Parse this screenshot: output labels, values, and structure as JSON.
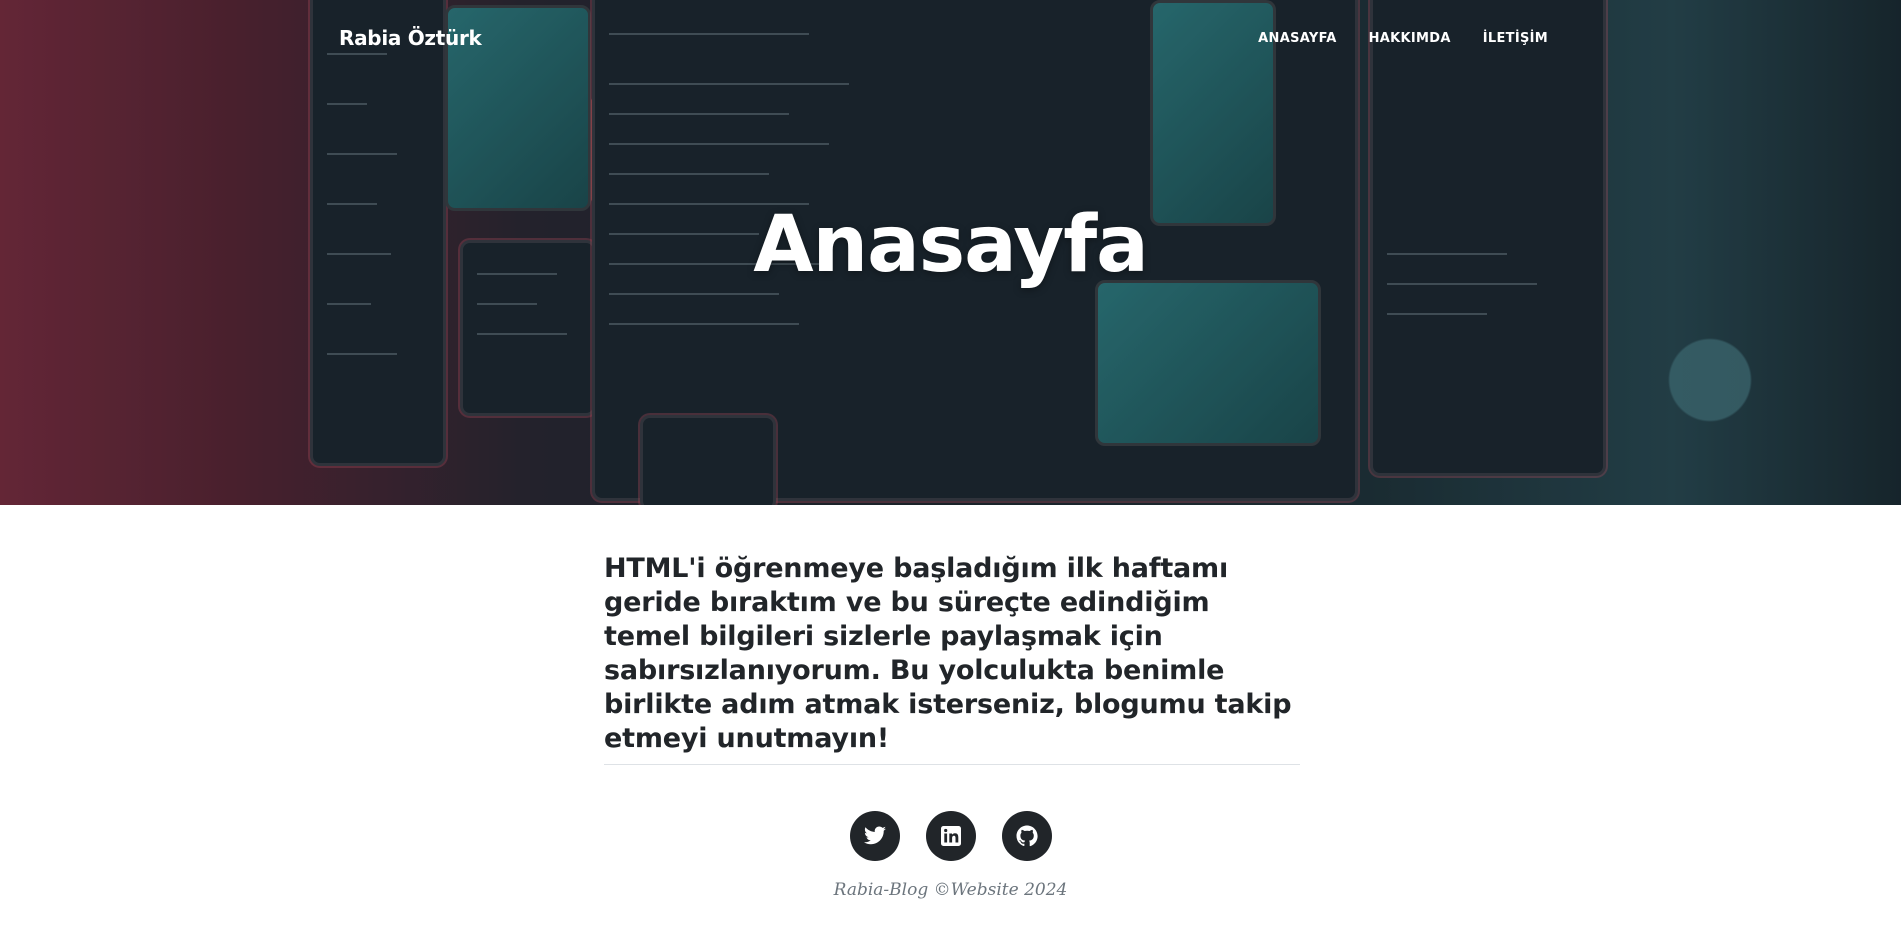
{
  "header": {
    "brand": "Rabia Öztürk",
    "nav": [
      {
        "label": "ANASAYFA"
      },
      {
        "label": "HAKKIMDA"
      },
      {
        "label": "İLETİŞİM"
      }
    ]
  },
  "hero": {
    "title": "Anasayfa"
  },
  "main": {
    "intro": "HTML'i öğrenmeye başladığım ilk haftamı geride bıraktım ve bu süreçte edindiğim temel bilgileri sizlerle paylaşmak için sabırsızlanıyorum. Bu yolculukta benimle birlikte adım atmak isterseniz, blogumu takip etmeyi unutmayın!"
  },
  "footer": {
    "socials": [
      {
        "icon": "twitter-icon"
      },
      {
        "icon": "linkedin-icon"
      },
      {
        "icon": "github-icon"
      }
    ],
    "copyright": "Rabia-Blog ©Website 2024"
  },
  "colors": {
    "text_dark": "#212529",
    "text_muted": "#6c757d",
    "social_bg": "#212529"
  }
}
